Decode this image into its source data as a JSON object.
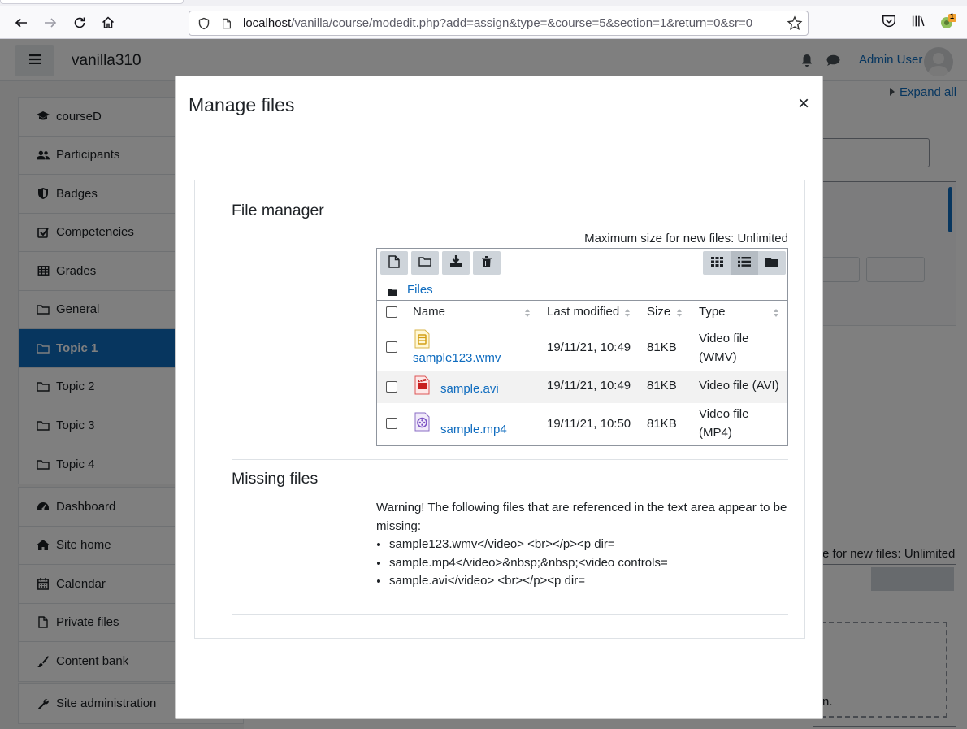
{
  "browser": {
    "url_host": "localhost",
    "url_path": "/vanilla/course/modedit.php?add=assign&type=&course=5&section=1&return=0&sr=0",
    "badge_count": "1"
  },
  "navbar": {
    "site_name": "vanilla310",
    "user_name": "Admin User"
  },
  "drawer": {
    "course_items": [
      {
        "label": "courseD",
        "icon": "graduation-cap-icon"
      },
      {
        "label": "Participants",
        "icon": "users-icon"
      },
      {
        "label": "Badges",
        "icon": "shield-icon"
      },
      {
        "label": "Competencies",
        "icon": "checkbox-icon"
      },
      {
        "label": "Grades",
        "icon": "table-icon"
      },
      {
        "label": "General",
        "icon": "folder-icon"
      },
      {
        "label": "Topic 1",
        "icon": "folder-icon",
        "active": true
      },
      {
        "label": "Topic 2",
        "icon": "folder-icon"
      },
      {
        "label": "Topic 3",
        "icon": "folder-icon"
      },
      {
        "label": "Topic 4",
        "icon": "folder-icon"
      }
    ],
    "site_items": [
      {
        "label": "Dashboard",
        "icon": "dashboard-icon"
      },
      {
        "label": "Site home",
        "icon": "home-icon"
      },
      {
        "label": "Calendar",
        "icon": "calendar-icon"
      },
      {
        "label": "Private files",
        "icon": "file-icon"
      },
      {
        "label": "Content bank",
        "icon": "paintbrush-icon"
      }
    ],
    "admin_items": [
      {
        "label": "Site administration",
        "icon": "wrench-icon"
      }
    ],
    "active_color": "#0f6cbf"
  },
  "background_page": {
    "expand_all": "Expand all",
    "max_size_fragment": "e for new files: Unlimited",
    "dash_fragment": "n."
  },
  "modal": {
    "title": "Manage files",
    "close_symbol": "×",
    "file_manager": {
      "title": "File manager",
      "max_size_text": "Maximum size for new files: Unlimited",
      "breadcrumb": "Files",
      "columns": {
        "name": "Name",
        "last_modified": "Last modified",
        "size": "Size",
        "type": "Type"
      },
      "files": [
        {
          "name": "sample123.wmv",
          "modified": "19/11/21, 10:49",
          "size": "81KB",
          "type_line1": "Video file",
          "type_line2": "(WMV)",
          "icon": "wmv-file-icon"
        },
        {
          "name": "sample.avi",
          "modified": "19/11/21, 10:49",
          "size": "81KB",
          "type_line1": "Video file (AVI)",
          "type_line2": "",
          "icon": "avi-file-icon"
        },
        {
          "name": "sample.mp4",
          "modified": "19/11/21, 10:50",
          "size": "81KB",
          "type_line1": "Video file",
          "type_line2": "(MP4)",
          "icon": "mp4-file-icon"
        }
      ]
    },
    "missing": {
      "title": "Missing files",
      "warning": "Warning! The following files that are referenced in the text area appear to be missing:",
      "items": [
        "sample123.wmv</video> <br></p><p dir=",
        "sample.mp4</video>&nbsp;&nbsp;<video controls=",
        "sample.avi</video> <br></p><p dir="
      ]
    }
  }
}
